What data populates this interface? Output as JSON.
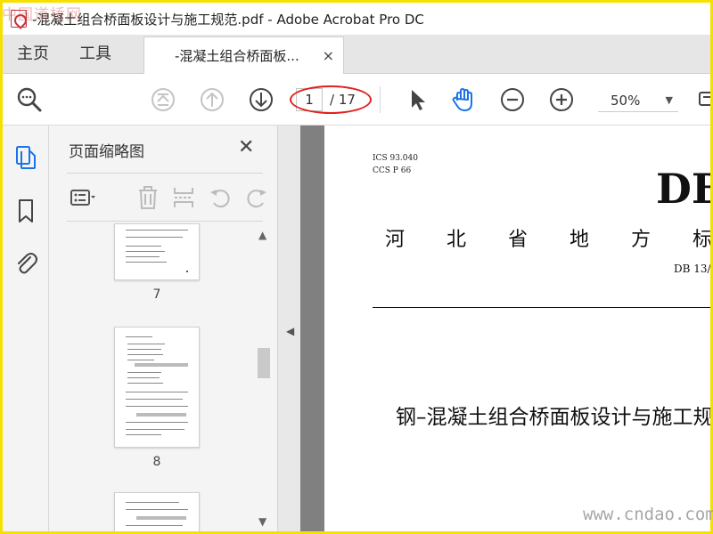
{
  "watermark_top": "中国道桥网",
  "watermark_bottom": "www.cndao.com",
  "window": {
    "title": "-混凝土组合桥面板设计与施工规范.pdf - Adobe Acrobat Pro DC"
  },
  "nav": {
    "home": "主页",
    "tools": "工具",
    "active_tab": "-混凝土组合桥面板...",
    "tab_close": "×"
  },
  "toolbar": {
    "page_current": "1",
    "page_total": "/ 17",
    "zoom": "50%",
    "zoom_caret": "▼"
  },
  "thumbnails_panel": {
    "title": "页面缩略图",
    "close": "✕",
    "pages": [
      {
        "label": "7"
      },
      {
        "label": "8"
      },
      {
        "label": ""
      }
    ]
  },
  "document": {
    "ics": "ICS 93.040",
    "ccs": "CCS P 66",
    "header_code": "DB",
    "province_line": "河北省地方标",
    "std_number": "DB 13/",
    "doc_title": "钢–混凝土组合桥面板设计与施工规"
  },
  "colors": {
    "accent_blue": "#1b73e8",
    "highlight_red": "#e02020",
    "frame_yellow": "#f5e000"
  }
}
